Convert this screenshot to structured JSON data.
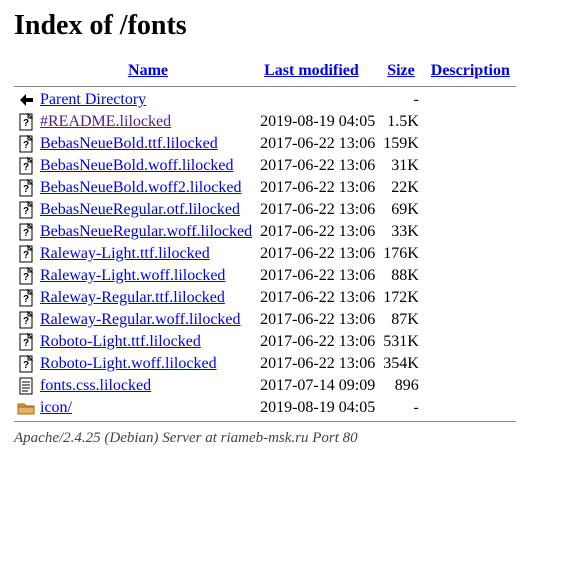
{
  "title": "Index of /fonts",
  "headers": {
    "name": "Name",
    "modified": "Last modified",
    "size": "Size",
    "description": "Description"
  },
  "rows": [
    {
      "icon": "back",
      "name": "Parent Directory",
      "modified": "",
      "size": "-",
      "visited": false
    },
    {
      "icon": "unknown",
      "name": "#README.lilocked",
      "modified": "2019-08-19 04:05",
      "size": "1.5K",
      "visited": true
    },
    {
      "icon": "unknown",
      "name": "BebasNeueBold.ttf.lilocked",
      "modified": "2017-06-22 13:06",
      "size": "159K",
      "visited": false
    },
    {
      "icon": "unknown",
      "name": "BebasNeueBold.woff.lilocked",
      "modified": "2017-06-22 13:06",
      "size": "31K",
      "visited": false
    },
    {
      "icon": "unknown",
      "name": "BebasNeueBold.woff2.lilocked",
      "modified": "2017-06-22 13:06",
      "size": "22K",
      "visited": false
    },
    {
      "icon": "unknown",
      "name": "BebasNeueRegular.otf.lilocked",
      "modified": "2017-06-22 13:06",
      "size": "69K",
      "visited": false
    },
    {
      "icon": "unknown",
      "name": "BebasNeueRegular.woff.lilocked",
      "modified": "2017-06-22 13:06",
      "size": "33K",
      "visited": false
    },
    {
      "icon": "unknown",
      "name": "Raleway-Light.ttf.lilocked",
      "modified": "2017-06-22 13:06",
      "size": "176K",
      "visited": false
    },
    {
      "icon": "unknown",
      "name": "Raleway-Light.woff.lilocked",
      "modified": "2017-06-22 13:06",
      "size": "88K",
      "visited": false
    },
    {
      "icon": "unknown",
      "name": "Raleway-Regular.ttf.lilocked",
      "modified": "2017-06-22 13:06",
      "size": "172K",
      "visited": false
    },
    {
      "icon": "unknown",
      "name": "Raleway-Regular.woff.lilocked",
      "modified": "2017-06-22 13:06",
      "size": "87K",
      "visited": false
    },
    {
      "icon": "unknown",
      "name": "Roboto-Light.ttf.lilocked",
      "modified": "2017-06-22 13:06",
      "size": "531K",
      "visited": false
    },
    {
      "icon": "unknown",
      "name": "Roboto-Light.woff.lilocked",
      "modified": "2017-06-22 13:06",
      "size": "354K",
      "visited": false
    },
    {
      "icon": "text",
      "name": "fonts.css.lilocked",
      "modified": "2017-07-14 09:09",
      "size": "896",
      "visited": false
    },
    {
      "icon": "folder",
      "name": "icon/",
      "modified": "2019-08-19 04:05",
      "size": "-",
      "visited": false
    }
  ],
  "footer": "Apache/2.4.25 (Debian) Server at riameb-msk.ru Port 80"
}
